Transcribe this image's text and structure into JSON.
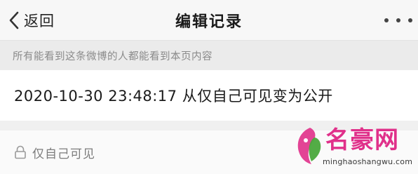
{
  "nav": {
    "back_label": "返回",
    "title": "编辑记录",
    "more_icon": "more-dots-icon"
  },
  "notice": {
    "text": "所有能看到这条微博的人都能看到本页内容"
  },
  "record": {
    "text": "2020-10-30 23:48:17 从仅自己可见变为公开"
  },
  "visibility": {
    "icon": "lock-icon",
    "label": "仅自己可见"
  },
  "watermark": {
    "title": "名豪网",
    "url": "minghaoshangwu.com"
  },
  "colors": {
    "watermark_pink": "#e0308a",
    "watermark_green": "#4aa83c",
    "notice_text": "#8a8a8a"
  }
}
